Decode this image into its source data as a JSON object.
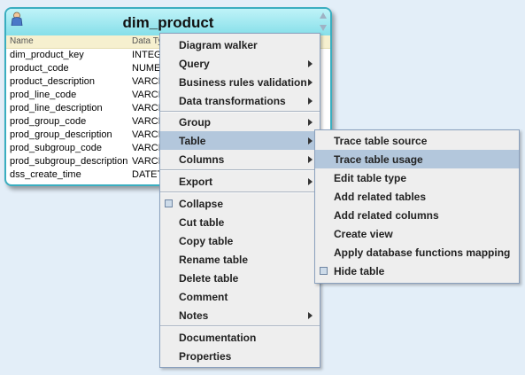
{
  "table_node": {
    "title": "dim_product",
    "headers": [
      "Name",
      "Data Ty"
    ],
    "rows": [
      {
        "name": "dim_product_key",
        "type": "INTEGE"
      },
      {
        "name": "product_code",
        "type": "NUMER"
      },
      {
        "name": "product_description",
        "type": "VARCH"
      },
      {
        "name": "prod_line_code",
        "type": "VARCH"
      },
      {
        "name": "prod_line_description",
        "type": "VARCH"
      },
      {
        "name": "prod_group_code",
        "type": "VARCH"
      },
      {
        "name": "prod_group_description",
        "type": "VARCH"
      },
      {
        "name": "prod_subgroup_code",
        "type": "VARCH"
      },
      {
        "name": "prod_subgroup_description",
        "type": "VARCH"
      },
      {
        "name": "dss_create_time",
        "type": "DATET"
      }
    ]
  },
  "context_menu": {
    "items": [
      {
        "label": "Diagram walker",
        "submenu": false
      },
      {
        "label": "Query",
        "submenu": true
      },
      {
        "label": "Business rules validation",
        "submenu": true
      },
      {
        "label": "Data transformations",
        "submenu": true
      },
      {
        "label": "Group",
        "submenu": true
      },
      {
        "label": "Table",
        "submenu": true,
        "highlighted": true
      },
      {
        "label": "Columns",
        "submenu": true
      },
      {
        "label": "Export",
        "submenu": true
      },
      {
        "label": "Collapse",
        "submenu": false,
        "checkbox": true
      },
      {
        "label": "Cut table",
        "submenu": false
      },
      {
        "label": "Copy table",
        "submenu": false
      },
      {
        "label": "Rename table",
        "submenu": false
      },
      {
        "label": "Delete table",
        "submenu": false
      },
      {
        "label": "Comment",
        "submenu": false
      },
      {
        "label": "Notes",
        "submenu": true
      },
      {
        "label": "Documentation",
        "submenu": false
      },
      {
        "label": "Properties",
        "submenu": false
      }
    ]
  },
  "table_submenu": {
    "items": [
      {
        "label": "Trace table source"
      },
      {
        "label": "Trace table usage",
        "highlighted": true
      },
      {
        "label": "Edit table type"
      },
      {
        "label": "Add related tables"
      },
      {
        "label": "Add related columns"
      },
      {
        "label": "Create view"
      },
      {
        "label": "Apply database functions mapping"
      },
      {
        "label": "Hide table",
        "checkbox": true
      }
    ]
  },
  "colors": {
    "canvas_bg": "#e3eef8",
    "node_border": "#3aaec0",
    "menu_highlight": "#b3c7dc",
    "header_strip": "#f6f0cf"
  }
}
